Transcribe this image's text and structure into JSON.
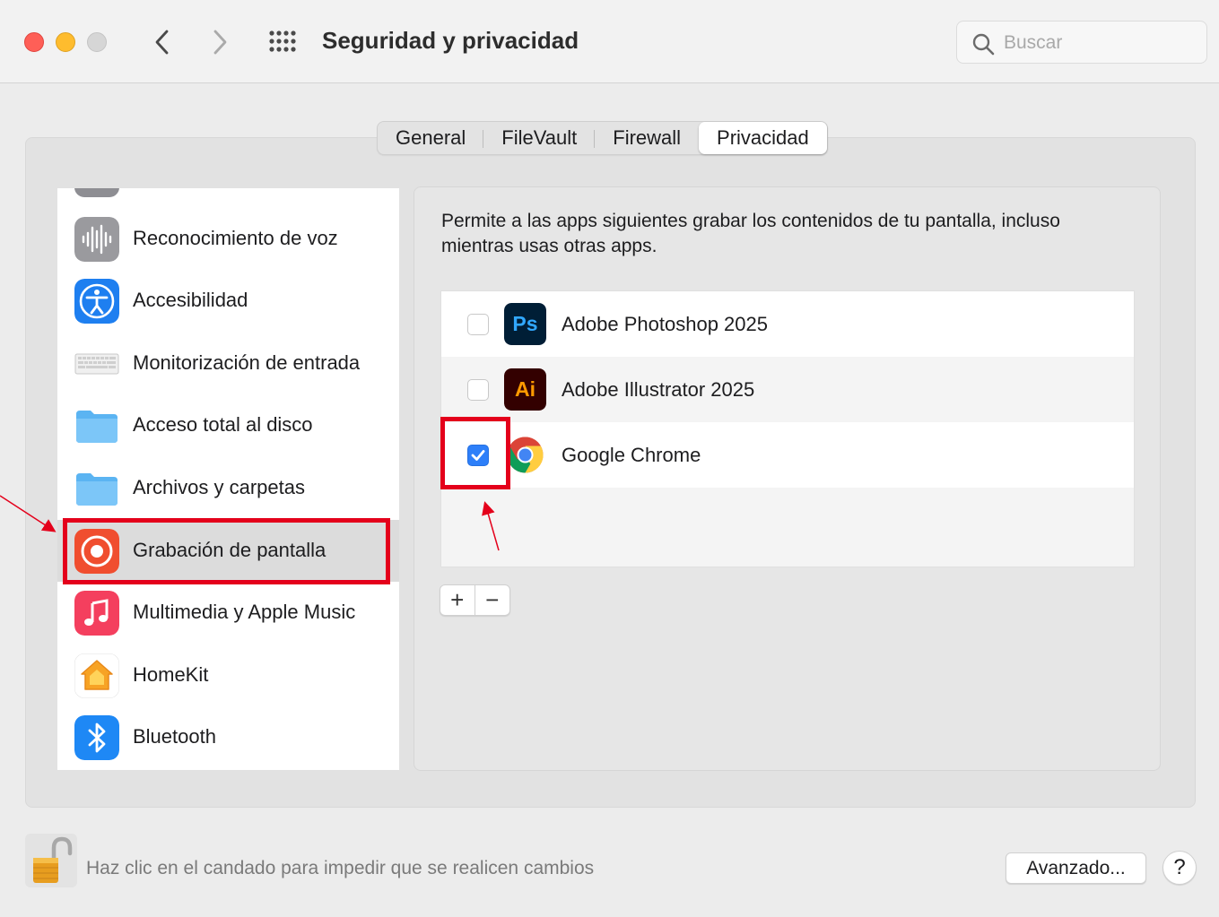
{
  "window": {
    "title": "Seguridad y privacidad",
    "search_placeholder": "Buscar"
  },
  "tabs": [
    {
      "label": "General",
      "active": false
    },
    {
      "label": "FileVault",
      "active": false
    },
    {
      "label": "Firewall",
      "active": false
    },
    {
      "label": "Privacidad",
      "active": true
    }
  ],
  "sidebar": {
    "items": [
      {
        "label": "Reconocimiento de voz",
        "icon": "waveform-icon"
      },
      {
        "label": "Accesibilidad",
        "icon": "accessibility-icon"
      },
      {
        "label": "Monitorización de entrada",
        "icon": "keyboard-icon"
      },
      {
        "label": "Acceso total al disco",
        "icon": "folder-icon"
      },
      {
        "label": "Archivos y carpetas",
        "icon": "folder-icon"
      },
      {
        "label": "Grabación de pantalla",
        "icon": "screen-recording-icon",
        "selected": true
      },
      {
        "label": "Multimedia y Apple Music",
        "icon": "music-icon"
      },
      {
        "label": "HomeKit",
        "icon": "home-icon"
      },
      {
        "label": "Bluetooth",
        "icon": "bluetooth-icon"
      }
    ]
  },
  "detail": {
    "description": "Permite a las apps siguientes grabar los contenidos de tu pantalla, incluso mientras usas otras apps.",
    "apps": [
      {
        "name": "Adobe Photoshop 2025",
        "checked": false,
        "icon_text": "Ps"
      },
      {
        "name": "Adobe Illustrator 2025",
        "checked": false,
        "icon_text": "Ai"
      },
      {
        "name": "Google Chrome",
        "checked": true,
        "icon_text": ""
      }
    ],
    "add_label": "+",
    "remove_label": "−"
  },
  "footer": {
    "lock_text": "Haz clic en el candado para impedir que se realicen cambios",
    "advanced_label": "Avanzado...",
    "help_label": "?"
  },
  "colors": {
    "accent": "#2d7ff9",
    "highlight": "#e4001b"
  }
}
